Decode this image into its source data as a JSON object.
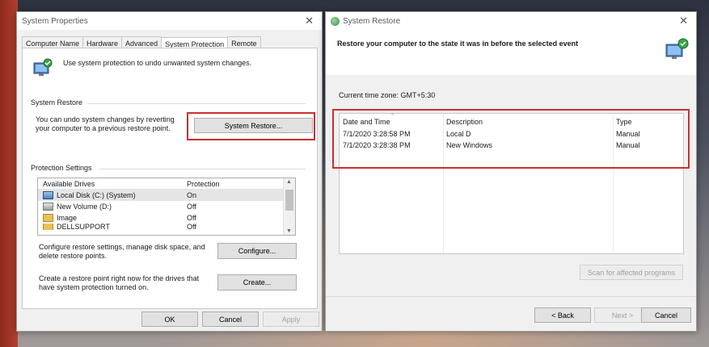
{
  "system_properties": {
    "title": "System Properties",
    "tabs": [
      "Computer Name",
      "Hardware",
      "Advanced",
      "System Protection",
      "Remote"
    ],
    "active_tab": "System Protection",
    "intro_text": "Use system protection to undo unwanted system changes.",
    "system_restore_group": "System Restore",
    "system_restore_text": "You can undo system changes by reverting your computer to a previous restore point.",
    "system_restore_button": "System Restore...",
    "protection_group": "Protection Settings",
    "drives_header": {
      "name": "Available Drives",
      "protection": "Protection"
    },
    "drives": [
      {
        "name": "Local Disk (C:) (System)",
        "protection": "On",
        "icon": "system-drive-icon"
      },
      {
        "name": "New Volume (D:)",
        "protection": "Off",
        "icon": "drive-icon"
      },
      {
        "name": "Image",
        "protection": "Off",
        "icon": "folder-drive-icon"
      },
      {
        "name": "DELLSUPPORT",
        "protection": "Off",
        "icon": "folder-drive-icon"
      }
    ],
    "configure_text": "Configure restore settings, manage disk space, and delete restore points.",
    "configure_button": "Configure...",
    "create_text": "Create a restore point right now for the drives that have system protection turned on.",
    "create_button": "Create...",
    "ok_button": "OK",
    "cancel_button": "Cancel",
    "apply_button": "Apply"
  },
  "system_restore": {
    "title": "System Restore",
    "heading": "Restore your computer to the state it was in before the selected event",
    "timezone": "Current time zone: GMT+5:30",
    "columns": [
      "Date and Time",
      "Description",
      "Type"
    ],
    "points": [
      {
        "date": "7/1/2020 3:28:58 PM",
        "description": "Local D",
        "type": "Manual"
      },
      {
        "date": "7/1/2020 3:28:38 PM",
        "description": "New Windows",
        "type": "Manual"
      }
    ],
    "scan_button": "Scan for affected programs",
    "back_button": "< Back",
    "next_button": "Next >",
    "cancel_button": "Cancel"
  },
  "colors": {
    "highlight": "#c83030",
    "window_bg": "#f0f0f0"
  }
}
